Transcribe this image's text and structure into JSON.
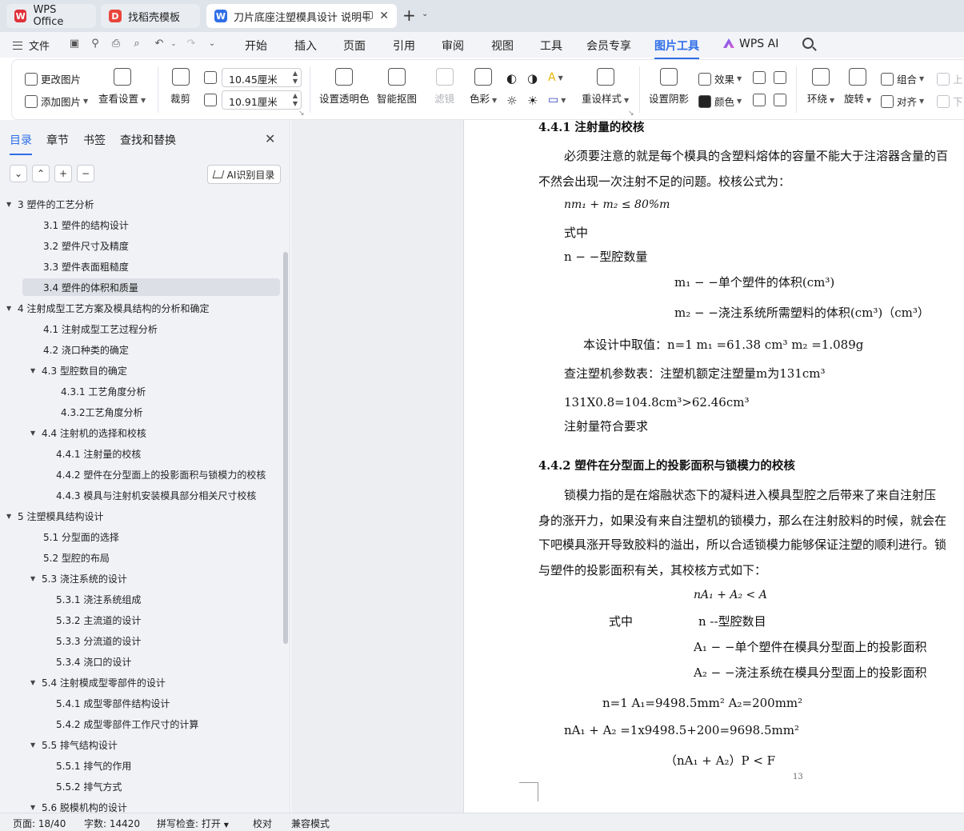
{
  "tabs": {
    "wps_office": "WPS Office",
    "template": "找稻壳模板",
    "document": "刀片底座注塑模具设计 说明书"
  },
  "menu": {
    "file": "文件",
    "items": [
      "开始",
      "插入",
      "页面",
      "引用",
      "审阅",
      "视图",
      "工具",
      "会员专享",
      "图片工具",
      "WPS AI"
    ]
  },
  "ribbon": {
    "change_image": "更改图片",
    "add_image": "添加图片",
    "view_settings": "查看设置",
    "crop": "裁剪",
    "width_value": "10.45厘米",
    "height_value": "10.91厘米",
    "set_transparent": "设置透明色",
    "smart_cutout": "智能抠图",
    "filter": "滤镜",
    "color": "色彩",
    "reset_style": "重设样式",
    "set_shadow": "设置阴影",
    "effect": "效果",
    "recolor": "颜色",
    "wrap": "环绕",
    "rotate": "旋转",
    "group": "组合",
    "align": "对齐",
    "up": "上",
    "down": "下"
  },
  "nav": {
    "tabs": [
      "目录",
      "章节",
      "书签",
      "查找和替换"
    ],
    "ai_button": "AI识别目录",
    "toc": [
      {
        "text": "3  塑件的工艺分析",
        "level": 0,
        "arrow": true
      },
      {
        "text": "3.1  塑件的结构设计",
        "level": 1
      },
      {
        "text": "3.2  塑件尺寸及精度",
        "level": 1
      },
      {
        "text": "3.3  塑件表面粗糙度",
        "level": 1
      },
      {
        "text": "3.4  塑件的体积和质量",
        "level": 1,
        "selected": true
      },
      {
        "text": "4  注射成型工艺方案及模具结构的分析和确定",
        "level": 0,
        "arrow": true
      },
      {
        "text": "4.1  注射成型工艺过程分析",
        "level": 1
      },
      {
        "text": "4.2 浇口种类的确定",
        "level": 1
      },
      {
        "text": "4.3  型腔数目的确定",
        "level": 1,
        "arrow": true
      },
      {
        "text": "4.3.1 工艺角度分析",
        "level": 3
      },
      {
        "text": "4.3.2工艺角度分析",
        "level": 3
      },
      {
        "text": "4.4  注射机的选择和校核",
        "level": 1,
        "arrow": true
      },
      {
        "text": "4.4.1  注射量的校核",
        "level": 2
      },
      {
        "text": "4.4.2  塑件在分型面上的投影面积与锁模力的校核",
        "level": 2
      },
      {
        "text": "4.4.3  模具与注射机安装模具部分相关尺寸校核",
        "level": 2
      },
      {
        "text": "5 注塑模具结构设计",
        "level": 0,
        "arrow": true
      },
      {
        "text": "5.1  分型面的选择",
        "level": 1
      },
      {
        "text": "5.2  型腔的布局",
        "level": 1
      },
      {
        "text": "5.3  浇注系统的设计",
        "level": 1,
        "arrow": true
      },
      {
        "text": "5.3.1  浇注系统组成",
        "level": 2
      },
      {
        "text": "5.3.2  主流道的设计",
        "level": 2
      },
      {
        "text": "5.3.3  分流道的设计",
        "level": 2
      },
      {
        "text": "5.3.4  浇口的设计",
        "level": 2
      },
      {
        "text": "5.4  注射模成型零部件的设计",
        "level": 1,
        "arrow": true
      },
      {
        "text": "5.4.1  成型零部件结构设计",
        "level": 2
      },
      {
        "text": "5.4.2  成型零部件工作尺寸的计算",
        "level": 2
      },
      {
        "text": "5.5  排气结构设计",
        "level": 1,
        "arrow": true
      },
      {
        "text": "5.5.1 排气的作用",
        "level": 2
      },
      {
        "text": "5.5.2 排气方式",
        "level": 2
      },
      {
        "text": "5.6  脱模机构的设计",
        "level": 1,
        "arrow": true
      }
    ]
  },
  "doc": {
    "h441": "4.4.1  注射量的校核",
    "p1a": "必须要注意的就是每个模具的含塑料熔体的容量不能大于注溶器含量的百",
    "p1b": "不然会出现一次注射不足的问题。校核公式为：",
    "formula1": "nm₁ + m₂ ≤ 80%m",
    "shizhong": "式中",
    "n_def": "n − −型腔数量",
    "m1_def": "m₁ − −单个塑件的体积(cm³)",
    "m2_def": "m₂ − −浇注系统所需塑料的体积(cm³)（cm³）",
    "values": "本设计中取值：n=1   m₁ =61.38  cm³    m₂ =1.089g",
    "lookup": "查注塑机参数表：注塑机额定注塑量m为131cm³",
    "calc": "131X0.8=104.8cm³>62.46cm³",
    "ok": "注射量符合要求",
    "h442": "4.4.2  塑件在分型面上的投影面积与锁模力的校核",
    "p2a": "锁模力指的是在熔融状态下的凝料进入模具型腔之后带来了来自注射压",
    "p2b": "身的涨开力，如果没有来自注塑机的锁模力，那么在注射胶料的时候，就会在",
    "p2c": "下吧模具涨开导致胶料的溢出，所以合适锁模力能够保证注塑的顺利进行。锁",
    "p2d": "与塑件的投影面积有关，其校核方式如下：",
    "formula2": "nA₁ + A₂ < A",
    "shizhong2": "式中",
    "n_def2": "n  --型腔数目",
    "a1_def": "A₁ − −单个塑件在模具分型面上的投影面积",
    "a2_def": "A₂ − −浇注系统在模具分型面上的投影面积",
    "vals2": "n=1     A₁=9498.5mm²     A₂=200mm²",
    "calc2": "nA₁ + A₂ =1x9498.5+200=9698.5mm²",
    "ineq": "（nA₁ + A₂）P  <  F",
    "page": "13"
  },
  "status": {
    "page": "页面: 18/40",
    "words": "字数: 14420",
    "spell": "拼写检查: 打开",
    "proof": "校对",
    "compat": "兼容模式"
  },
  "colors": {
    "accent": "#2f6ee8",
    "wps_red": "#e0313a"
  }
}
